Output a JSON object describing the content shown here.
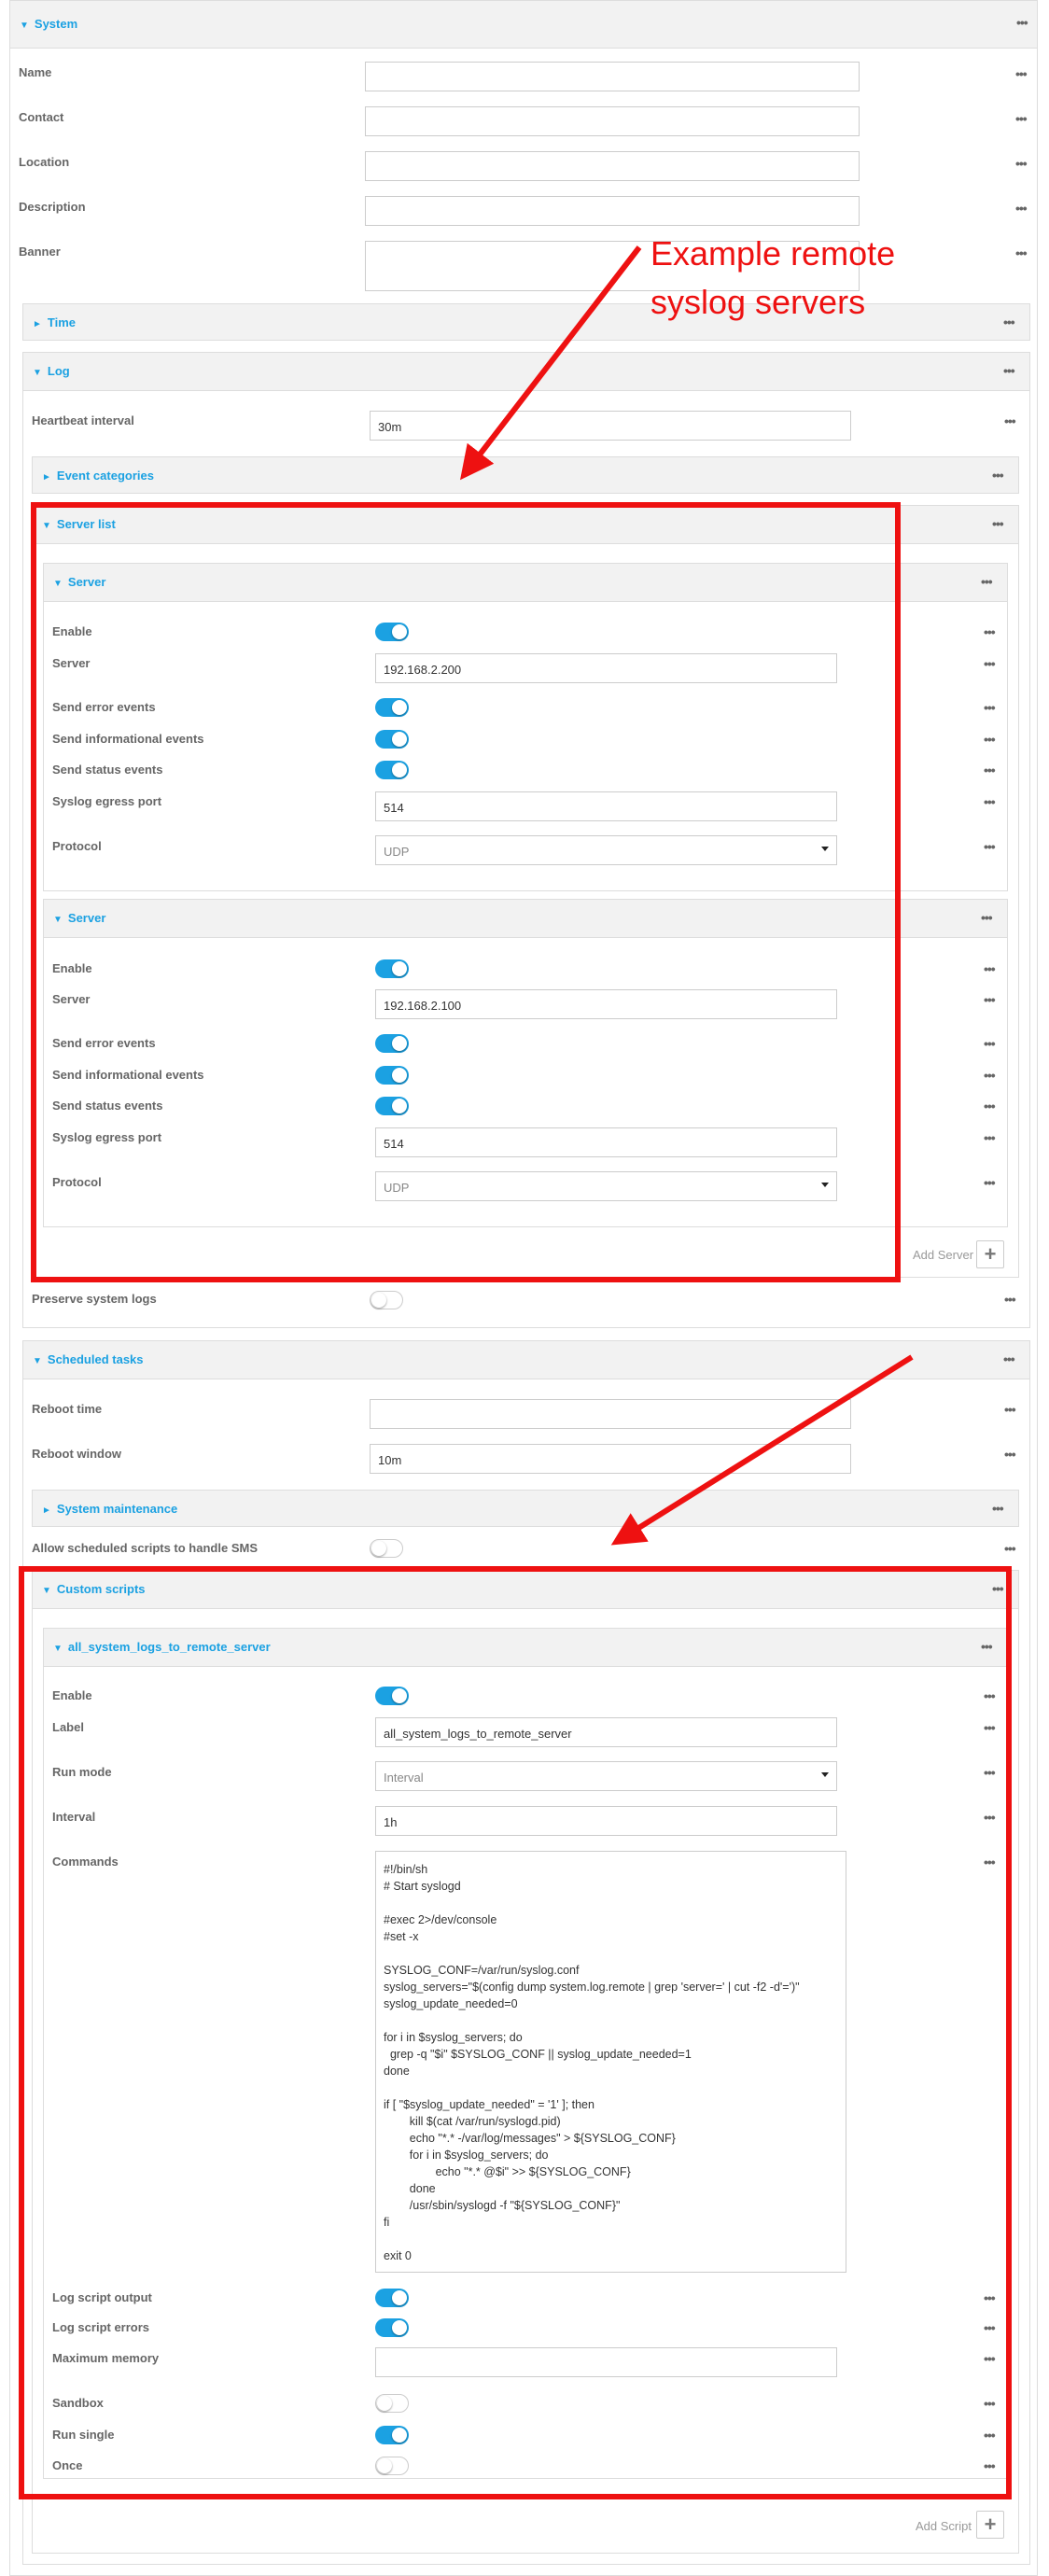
{
  "system": {
    "title": "System",
    "name_label": "Name",
    "name_value": "",
    "contact_label": "Contact",
    "contact_value": "",
    "location_label": "Location",
    "location_value": "",
    "description_label": "Description",
    "description_value": "",
    "banner_label": "Banner",
    "banner_value": ""
  },
  "time": {
    "title": "Time"
  },
  "log": {
    "title": "Log",
    "heartbeat_label": "Heartbeat interval",
    "heartbeat_value": "30m",
    "event_categories_title": "Event categories",
    "server_list": {
      "title": "Server list",
      "servers": [
        {
          "title": "Server",
          "enable_label": "Enable",
          "enable": true,
          "server_label": "Server",
          "server_value": "192.168.2.200",
          "send_error_label": "Send error events",
          "send_error": true,
          "send_info_label": "Send informational events",
          "send_info": true,
          "send_status_label": "Send status events",
          "send_status": true,
          "port_label": "Syslog egress port",
          "port_value": "514",
          "protocol_label": "Protocol",
          "protocol_value": "UDP"
        },
        {
          "title": "Server",
          "enable_label": "Enable",
          "enable": true,
          "server_label": "Server",
          "server_value": "192.168.2.100",
          "send_error_label": "Send error events",
          "send_error": true,
          "send_info_label": "Send informational events",
          "send_info": true,
          "send_status_label": "Send status events",
          "send_status": true,
          "port_label": "Syslog egress port",
          "port_value": "514",
          "protocol_label": "Protocol",
          "protocol_value": "UDP"
        }
      ],
      "add_label": "Add Server"
    },
    "preserve_label": "Preserve system logs",
    "preserve": false
  },
  "scheduled": {
    "title": "Scheduled tasks",
    "reboot_time_label": "Reboot time",
    "reboot_time_value": "",
    "reboot_window_label": "Reboot window",
    "reboot_window_value": "10m",
    "maintenance_title": "System maintenance",
    "allow_sms_label": "Allow scheduled scripts to handle SMS",
    "allow_sms": false,
    "custom_scripts": {
      "title": "Custom scripts",
      "script": {
        "title": "all_system_logs_to_remote_server",
        "enable_label": "Enable",
        "enable": true,
        "label_label": "Label",
        "label_value": "all_system_logs_to_remote_server",
        "run_mode_label": "Run mode",
        "run_mode_value": "Interval",
        "interval_label": "Interval",
        "interval_value": "1h",
        "commands_label": "Commands",
        "commands_value": "#!/bin/sh\n# Start syslogd\n\n#exec 2>/dev/console\n#set -x\n\nSYSLOG_CONF=/var/run/syslog.conf\nsyslog_servers=\"$(config dump system.log.remote | grep 'server=' | cut -f2 -d'=')\"\nsyslog_update_needed=0\n\nfor i in $syslog_servers; do\n  grep -q \"$i\" $SYSLOG_CONF || syslog_update_needed=1\ndone\n\nif [ \"$syslog_update_needed\" = '1' ]; then\n        kill $(cat /var/run/syslogd.pid)\n        echo \"*.* -/var/log/messages\" > ${SYSLOG_CONF}\n        for i in $syslog_servers; do\n                echo \"*.* @$i\" >> ${SYSLOG_CONF}\n        done\n        /usr/sbin/syslogd -f \"${SYSLOG_CONF}\"\nfi\n\nexit 0",
        "log_output_label": "Log script output",
        "log_output": true,
        "log_errors_label": "Log script errors",
        "log_errors": true,
        "max_memory_label": "Maximum memory",
        "max_memory_value": "",
        "sandbox_label": "Sandbox",
        "sandbox": false,
        "run_single_label": "Run single",
        "run_single": true,
        "once_label": "Once",
        "once": false
      },
      "add_label": "Add Script"
    }
  },
  "annotation": {
    "text": "Example remote\nsyslog servers",
    "color": "#ee1111"
  },
  "colors": {
    "accent": "#1ba1e2",
    "annotation": "#ee1111",
    "toggle_on": "#1ba1e2"
  },
  "icons": {
    "menu": "more-dots-icon",
    "expand": "triangle-down-icon",
    "collapse": "triangle-right-icon",
    "add": "plus-icon"
  }
}
